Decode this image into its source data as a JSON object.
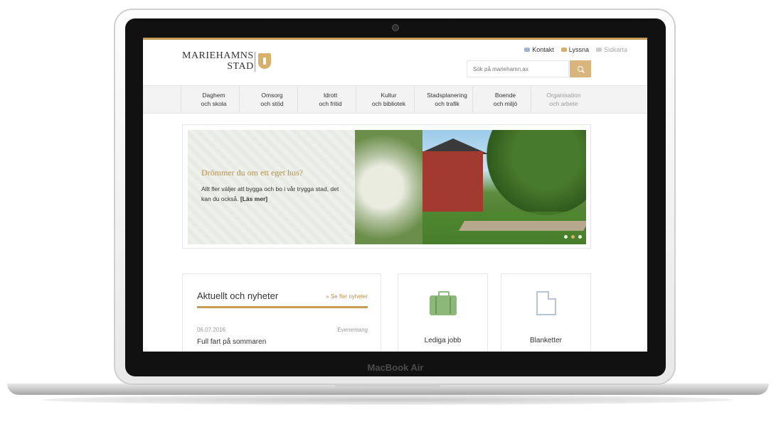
{
  "device": {
    "label": "MacBook Air"
  },
  "site": {
    "logo": {
      "line1": "MARIEHAMNS",
      "line2": "STAD"
    },
    "toplinks": [
      {
        "label": "Kontakt",
        "icon": "chat-icon"
      },
      {
        "label": "Lyssna",
        "icon": "speaker-icon"
      },
      {
        "label": "Sidkarta",
        "icon": "sitemap-icon"
      }
    ],
    "search": {
      "placeholder": "Sök på mariehamn.ax"
    },
    "nav": [
      {
        "l1": "Daghem",
        "l2": "och skola"
      },
      {
        "l1": "Omsorg",
        "l2": "och stöd"
      },
      {
        "l1": "Idrott",
        "l2": "och fritid"
      },
      {
        "l1": "Kultur",
        "l2": "och bibliotek"
      },
      {
        "l1": "Stadsplanering",
        "l2": "och trafik"
      },
      {
        "l1": "Boende",
        "l2": "och miljö"
      },
      {
        "l1": "Organisation",
        "l2": "och arbete"
      }
    ],
    "hero": {
      "title": "Drömmer du om ett eget hus?",
      "text": "Allt fler väljer att bygga och bo i vår trygga stad, det kan du också.",
      "link": "[Läs mer]",
      "slides": 3,
      "active_slide": 2
    },
    "news": {
      "title": "Aktuellt och nyheter",
      "more": "» Se fler nyheter",
      "items": [
        {
          "date": "06.07.2016",
          "category": "Evenemang",
          "headline": "Full fart på sommaren"
        }
      ]
    },
    "cards": [
      {
        "label": "Lediga jobb",
        "icon": "briefcase-icon"
      },
      {
        "label": "Blanketter",
        "icon": "document-icon"
      }
    ],
    "colors": {
      "accent": "#c69b55",
      "green": "#8eb87a",
      "nav_bg": "#f3f3f3"
    }
  }
}
